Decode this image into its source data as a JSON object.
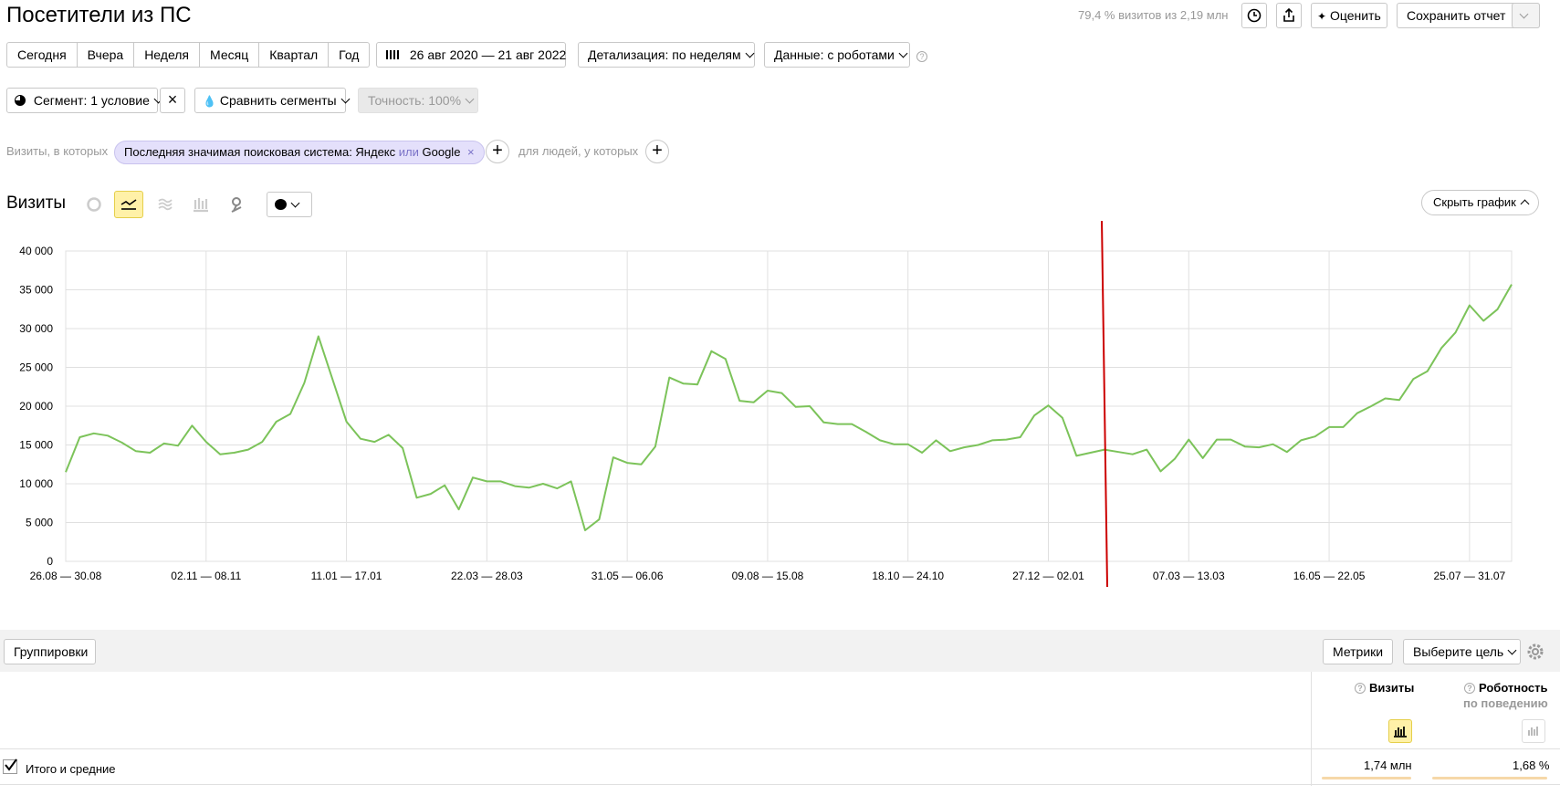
{
  "header": {
    "title": "Посетители из ПС",
    "share_text": "79,4 % визитов из 2,19 млн",
    "rate_label": "Оценить",
    "save_label": "Сохранить отчет"
  },
  "periods": [
    "Сегодня",
    "Вчера",
    "Неделя",
    "Месяц",
    "Квартал",
    "Год"
  ],
  "date_range": "26 авг 2020 — 21 авг 2022",
  "detail_label": "Детализация: по неделям",
  "data_label": "Данные: с роботами",
  "segment_label": "Сегмент: 1 условие",
  "compare_label": "Сравнить сегменты",
  "accuracy_label": "Точность: 100%",
  "filter": {
    "prefix": "Визиты, в которых",
    "chip_text": "Последняя значимая поисковая система: Яндекс",
    "chip_or": "или",
    "chip_tail": "Google",
    "people_label": "для людей, у которых"
  },
  "chart_header": {
    "title": "Визиты",
    "hide_label": "Скрыть график"
  },
  "chart_data": {
    "type": "line",
    "title": "",
    "ylim": [
      0,
      40000
    ],
    "yticks": [
      "0",
      "5 000",
      "10 000",
      "15 000",
      "20 000",
      "25 000",
      "30 000",
      "35 000",
      "40 000"
    ],
    "xticks": [
      "26.08 — 30.08",
      "02.11 — 08.11",
      "11.01 — 17.01",
      "22.03 — 28.03",
      "31.05 — 06.06",
      "09.08 — 15.08",
      "18.10 — 24.10",
      "27.12 — 02.01",
      "07.03 — 13.03",
      "16.05 — 22.05",
      "25.07 — 31.07"
    ],
    "grid": true,
    "color": "#7cc35a",
    "marker_color": "#cc0000",
    "series": [
      {
        "values": [
          11500,
          16000,
          16500,
          16200,
          15300,
          14200,
          14000,
          15200,
          14900,
          17500,
          15400,
          13800,
          14000,
          14400,
          15400,
          18000,
          19000,
          23000,
          29000,
          23500,
          18000,
          15800,
          15400,
          16300,
          14600,
          8200,
          8700,
          9800,
          6700,
          10800,
          10300,
          10300,
          9700,
          9500,
          10000,
          9400,
          10300,
          4000,
          5400,
          13400,
          12700,
          12500,
          14800,
          23700,
          22900,
          22800,
          27100,
          26100,
          20700,
          20500,
          22000,
          21700,
          19900,
          20000,
          17900,
          17700,
          17700,
          16700,
          15600,
          15100,
          15100,
          14000,
          15600,
          14200,
          14700,
          15000,
          15600,
          15700,
          16000,
          18800,
          20100,
          18500,
          13600,
          14000,
          14400,
          14100,
          13800,
          14400,
          11600,
          13200,
          15700,
          13300,
          15700,
          15700,
          14800,
          14700,
          15100,
          14100,
          15600,
          16100,
          17300,
          17300,
          19100,
          20000,
          21000,
          20800,
          23500,
          24500,
          27500,
          29500,
          33000,
          31000,
          32500,
          35700
        ]
      }
    ],
    "marker_index": 74
  },
  "table": {
    "groupings_label": "Группировки",
    "metrics_label": "Метрики",
    "goal_label": "Выберите цель",
    "col_visits": "Визиты",
    "col_robot": "Роботность",
    "col_robot_sub": "по поведению",
    "total_label": "Итого и средние",
    "total_visits": "1,74 млн",
    "total_robot": "1,68 %"
  }
}
